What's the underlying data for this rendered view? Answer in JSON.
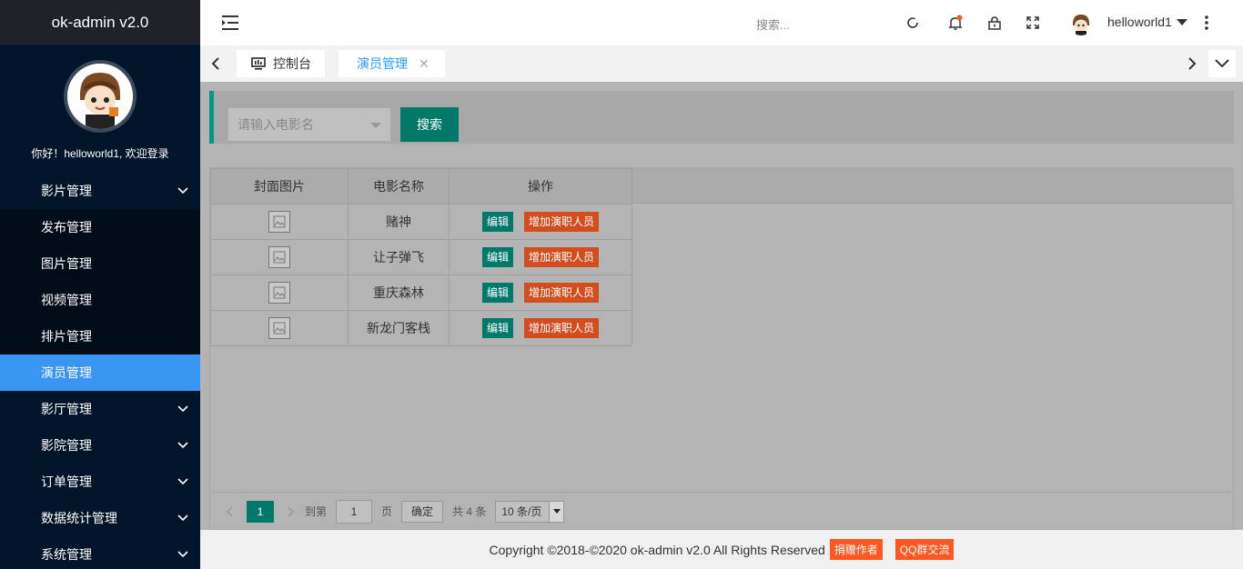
{
  "app": {
    "logo": "ok-admin v2.0"
  },
  "sidebar": {
    "welcome": "你好！helloworld1, 欢迎登录",
    "items": [
      {
        "label": "影片管理"
      },
      {
        "label": "发布管理"
      },
      {
        "label": "图片管理"
      },
      {
        "label": "视频管理"
      },
      {
        "label": "排片管理"
      },
      {
        "label": "演员管理"
      },
      {
        "label": "影厅管理"
      },
      {
        "label": "影院管理"
      },
      {
        "label": "订单管理"
      },
      {
        "label": "数据统计管理"
      },
      {
        "label": "系统管理"
      }
    ]
  },
  "header": {
    "search_placeholder": "搜索...",
    "username": "helloworld1"
  },
  "tabs": [
    {
      "label": "控制台"
    },
    {
      "label": "演员管理"
    }
  ],
  "search": {
    "select_placeholder": "请输入电影名",
    "button": "搜索"
  },
  "table": {
    "columns": [
      "封面图片",
      "电影名称",
      "操作"
    ],
    "rows": [
      {
        "name": "赌神",
        "edit": "编辑",
        "add": "增加演职人员"
      },
      {
        "name": "让子弹飞",
        "edit": "编辑",
        "add": "增加演职人员"
      },
      {
        "name": "重庆森林",
        "edit": "编辑",
        "add": "增加演职人员"
      },
      {
        "name": "新龙门客栈",
        "edit": "编辑",
        "add": "增加演职人员"
      }
    ]
  },
  "pager": {
    "current": "1",
    "goto_label": "到第",
    "goto_value": "1",
    "page_label": "页",
    "confirm": "确定",
    "total": "共 4 条",
    "page_size": "10 条/页"
  },
  "footer": {
    "copyright": "Copyright ©2018-©2020 ok-admin v2.0 All Rights Reserved",
    "donate": "捐赠作者",
    "qq": "QQ群交流"
  },
  "colors": {
    "sidebar_bg": "#001529",
    "active_menu": "#3a96f2",
    "primary": "#009688",
    "warm": "#ff5722"
  }
}
